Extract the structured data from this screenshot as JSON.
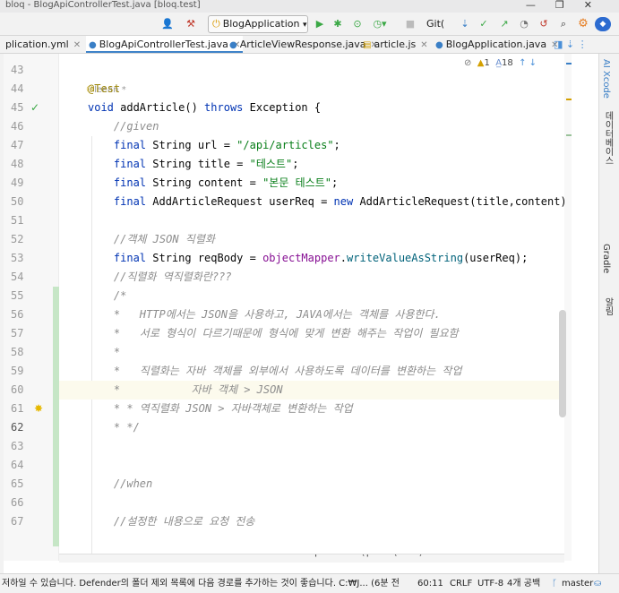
{
  "window": {
    "title": "bloq - BlogApiControllerTest.java [bloq.test]",
    "buttons": [
      "—",
      "❐",
      "✕"
    ]
  },
  "toolbar": {
    "run_config": "BlogApplication",
    "git_label": "Git(",
    "icons": [
      "user-icon",
      "hammer-icon",
      "run-icon",
      "debug-icon",
      "coverage-icon",
      "profile-icon",
      "stop-icon",
      "git-update-icon",
      "git-push-icon",
      "git-commit-icon",
      "history-icon",
      "rollback-icon",
      "search-icon",
      "settings-icon",
      "jetbrains-logo"
    ]
  },
  "tabs": [
    {
      "label": "plication.yml",
      "icon": "yaml-icon",
      "active": false
    },
    {
      "label": "BlogApiControllerTest.java",
      "icon": "java-class-icon",
      "active": true
    },
    {
      "label": "ArticleViewResponse.java",
      "icon": "java-class-icon",
      "active": false
    },
    {
      "label": "article.js",
      "icon": "js-file-icon",
      "active": false
    },
    {
      "label": "BlogApplication.java",
      "icon": "java-class-icon",
      "active": false
    }
  ],
  "inspection": {
    "warnings": "1",
    "weak_warnings": "18"
  },
  "author_hint": "leean *",
  "gutter_lines": [
    "43",
    "44",
    "45",
    "46",
    "47",
    "48",
    "49",
    "50",
    "51",
    "52",
    "53",
    "54",
    "55",
    "56",
    "57",
    "58",
    "59",
    "60",
    "61",
    "62",
    "63",
    "64",
    "65",
    "66",
    "67"
  ],
  "code": [
    [],
    [
      [
        "ann",
        "@Test"
      ]
    ],
    [
      [
        "kw",
        "void "
      ],
      [
        "",
        "addArticle() "
      ],
      [
        "kw",
        "throws "
      ],
      [
        "",
        "Exception {"
      ]
    ],
    [
      [
        "cmt",
        "    //given"
      ]
    ],
    [
      [
        "kw",
        "    final "
      ],
      [
        "",
        "String url = "
      ],
      [
        "str",
        "\"/api/articles\""
      ],
      [
        "",
        ";"
      ]
    ],
    [
      [
        "kw",
        "    final "
      ],
      [
        "",
        "String title = "
      ],
      [
        "str",
        "\"테스트\""
      ],
      [
        "",
        ";"
      ]
    ],
    [
      [
        "kw",
        "    final "
      ],
      [
        "",
        "String content = "
      ],
      [
        "str",
        "\"본문 테스트\""
      ],
      [
        "",
        ";"
      ]
    ],
    [
      [
        "kw",
        "    final "
      ],
      [
        "",
        "AddArticleRequest userReq = "
      ],
      [
        "kw",
        "new "
      ],
      [
        "",
        "AddArticleRequest(title,content);"
      ]
    ],
    [],
    [
      [
        "cmt",
        "    //객체 JSON 직렬화"
      ]
    ],
    [
      [
        "kw",
        "    final "
      ],
      [
        "",
        "String reqBody = "
      ],
      [
        "fld",
        "objectMapper"
      ],
      [
        "",
        "."
      ],
      [
        "mth",
        "writeValueAsString"
      ],
      [
        "",
        "(userReq);"
      ]
    ],
    [
      [
        "cmt",
        "    //직렬화 역직렬화란???"
      ]
    ],
    [
      [
        "cmt",
        "    /*"
      ]
    ],
    [
      [
        "cmt",
        "    *   HTTP에서는 JSON을 사용하고, JAVA에서는 객체를 사용한다."
      ]
    ],
    [
      [
        "cmt",
        "    *   서로 형식이 다르기때문에 형식에 맞게 변환 해주는 작업이 필요함"
      ]
    ],
    [
      [
        "cmt",
        "    *"
      ]
    ],
    [
      [
        "cmt",
        "    *   직렬화는 자바 객체를 외부에서 사용하도록 데이터를 변환하는 작업"
      ]
    ],
    [
      [
        "cmt",
        "    *           자바 객체 > JSON"
      ]
    ],
    [
      [
        "cmt",
        "    * * 역직렬화 JSON > 자바객체로 변환하는 작업"
      ]
    ],
    [
      [
        "cmt",
        "    * */"
      ]
    ],
    [],
    [],
    [
      [
        "cmt",
        "    //when"
      ]
    ],
    [],
    [
      [
        "cmt",
        "    //설정한 내용으로 요청 전송"
      ]
    ]
  ],
  "sticky_line": "    ResultActions result = mockMvc.perform(post(url)",
  "right_panels": [
    "AI Xcode",
    "데이터베이스",
    "Gradle",
    "알림"
  ],
  "status": {
    "message": "저하일 수 있습니다. Defender의 폴더 제외 목록에 다음 경로를 추가하는 것이 좋습니다. C:₩J... (6분 전",
    "position": "60:11",
    "line_sep": "CRLF",
    "encoding": "UTF-8",
    "indent": "4개 공백",
    "branch": "master"
  },
  "colors": {
    "accent": "#4083c9",
    "keyword": "#0033b3",
    "string": "#067d17",
    "comment": "#8c8c8c",
    "annotation": "#9e880d",
    "field": "#871094",
    "method": "#00627a",
    "run": "#3aa845"
  }
}
